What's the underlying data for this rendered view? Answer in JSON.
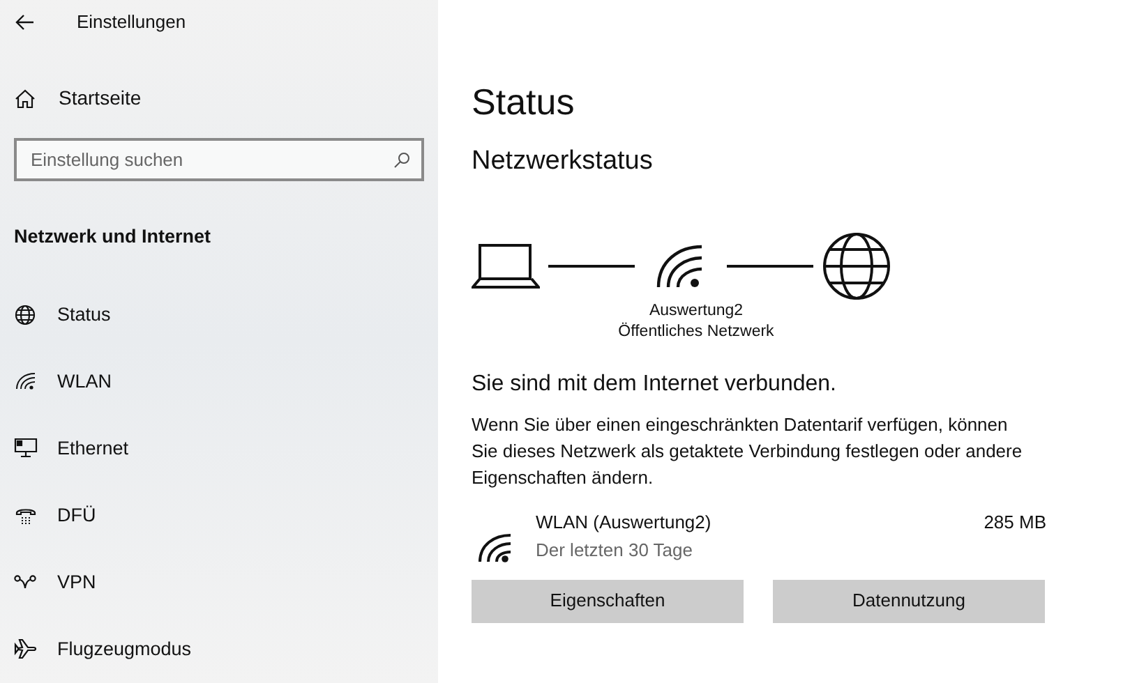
{
  "window": {
    "title": "Einstellungen"
  },
  "sidebar": {
    "home": "Startseite",
    "search": {
      "placeholder": "Einstellung suchen"
    },
    "section": "Netzwerk und Internet",
    "items": [
      {
        "label": "Status",
        "kind": "globe"
      },
      {
        "label": "WLAN",
        "kind": "wifi"
      },
      {
        "label": "Ethernet",
        "kind": "ethernet"
      },
      {
        "label": "DFÜ",
        "kind": "phone"
      },
      {
        "label": "VPN",
        "kind": "vpn"
      },
      {
        "label": "Flugzeugmodus",
        "kind": "plane"
      }
    ]
  },
  "main": {
    "title": "Status",
    "subtitle": "Netzwerkstatus",
    "network_name": "Auswertung2",
    "network_type": "Öffentliches Netzwerk",
    "connection_message": "Sie sind mit dem Internet verbunden.",
    "info": "Wenn Sie über einen eingeschränkten Datentarif verfügen, können Sie dieses Netzwerk als getaktete Verbindung festlegen oder andere Eigenschaften ändern.",
    "usage": {
      "name": "WLAN (Auswertung2)",
      "period": "Der letzten 30 Tage",
      "amount": "285 MB"
    },
    "buttons": [
      "Eigenschaften",
      "Datennutzung"
    ]
  }
}
